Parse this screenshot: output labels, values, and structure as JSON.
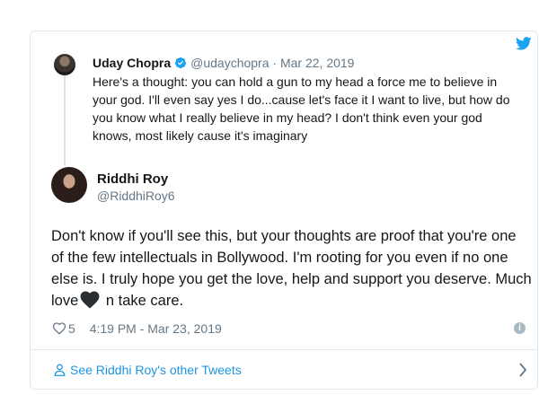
{
  "quoted_tweet": {
    "name": "Uday Chopra",
    "handle": "@udaychopra",
    "separator": "·",
    "date": "Mar 22, 2019",
    "text": "Here's a thought: you can hold a gun to my head a force me to believe in your god. I'll even say yes I do...cause let's face it I want to live, but how do you know what I really believe in my head? I don't think even your god knows, most likely cause it's imaginary"
  },
  "tweet": {
    "name": "Riddhi Roy",
    "handle": "@RiddhiRoy6",
    "text_before_heart": "Don't know if you'll see this, but your thoughts are proof that you're one of the few intellectuals in Bollywood. I'm rooting for you even if no one else is. I truly hope you get the love, help and support you deserve. Much love",
    "text_after_heart": " n take care.",
    "likes": "5",
    "timestamp": "4:19 PM - Mar 23, 2019"
  },
  "footer": {
    "see_more_label": "See Riddhi Roy's other Tweets"
  },
  "colors": {
    "twitter_blue": "#1da1f2",
    "link_blue": "#1b95e0",
    "muted": "#657786",
    "border": "#e1e8ed"
  },
  "icons": {
    "verified": "verified-badge-icon",
    "bird": "twitter-bird-icon",
    "heart": "heart-icon",
    "like": "like-heart-outline-icon",
    "info": "info-icon",
    "person": "person-icon",
    "chevron": "chevron-right-icon"
  }
}
